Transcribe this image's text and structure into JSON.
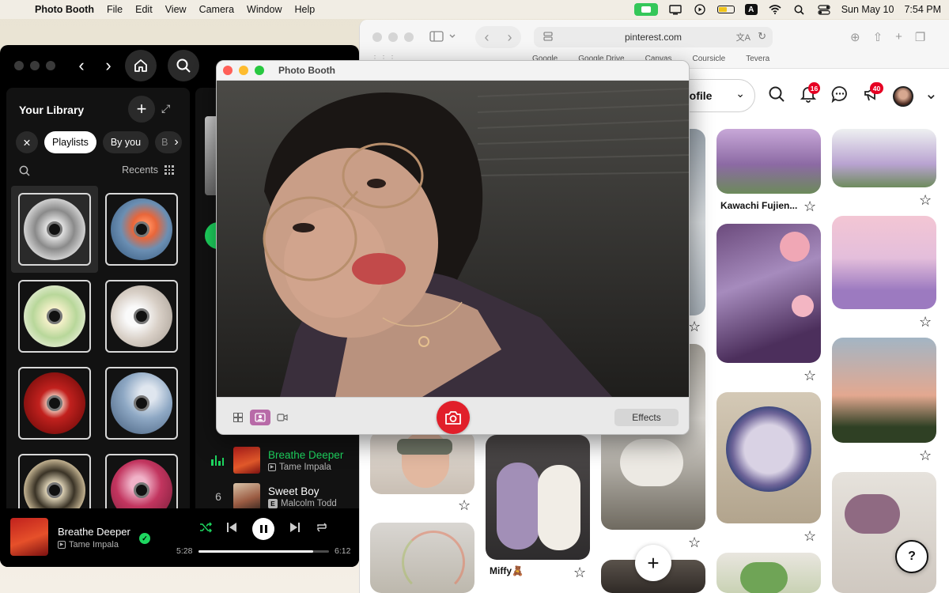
{
  "menubar": {
    "app_name": "Photo Booth",
    "menus": [
      "File",
      "Edit",
      "View",
      "Camera",
      "Window",
      "Help"
    ],
    "date": "Sun May 10",
    "time": "7:54 PM"
  },
  "spotify": {
    "library_title": "Your Library",
    "chips": [
      "Playlists",
      "By you",
      "B"
    ],
    "recents_label": "Recents",
    "tracks": [
      {
        "title": "Breathe Deeper",
        "artist": "Tame Impala"
      },
      {
        "num": "6",
        "title": "Sweet Boy",
        "artist": "Malcolm Todd",
        "explicit": "E"
      }
    ],
    "now_playing": {
      "title": "Breathe Deeper",
      "artist": "Tame Impala",
      "elapsed": "5:28",
      "duration": "6:12",
      "progress": 0.88
    },
    "accent": "#1ed760"
  },
  "safari": {
    "url": "pinterest.com",
    "favorites": [
      "Google",
      "Google Drive",
      "Canvas",
      "Coursicle",
      "Tevera"
    ]
  },
  "pinterest": {
    "profile_pill": "s profile",
    "notifications_count": "16",
    "messages_count": "40",
    "captions": [
      "Kawachi Fujien...",
      "Miffy🧸"
    ],
    "help_label": "?"
  },
  "photobooth": {
    "title": "Photo Booth",
    "effects_label": "Effects",
    "shutter_color": "#e11f2a"
  }
}
